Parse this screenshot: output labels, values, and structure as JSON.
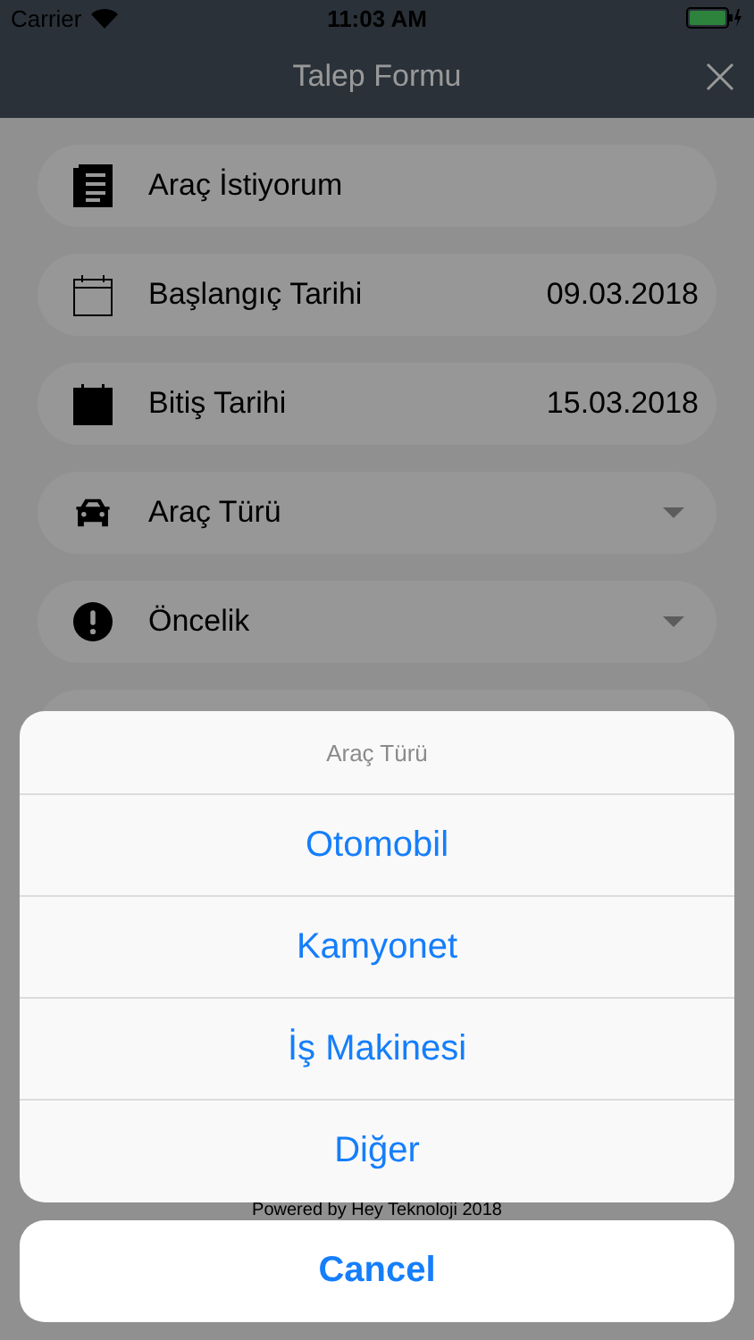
{
  "status_bar": {
    "carrier": "Carrier",
    "time": "11:03 AM"
  },
  "nav": {
    "title": "Talep Formu"
  },
  "fields": [
    {
      "kind": "text",
      "label": "Araç İstiyorum"
    },
    {
      "kind": "date",
      "label": "Başlangıç Tarihi",
      "value": "09.03.2018"
    },
    {
      "kind": "date",
      "label": "Bitiş Tarihi",
      "value": "15.03.2018"
    },
    {
      "kind": "select",
      "label": "Araç Türü"
    },
    {
      "kind": "select",
      "label": "Öncelik"
    },
    {
      "kind": "blank"
    }
  ],
  "footer": "Powered by Hey Teknoloji 2018",
  "action_sheet": {
    "title": "Araç Türü",
    "options": [
      "Otomobil",
      "Kamyonet",
      "İş Makinesi",
      "Diğer"
    ],
    "cancel": "Cancel"
  }
}
